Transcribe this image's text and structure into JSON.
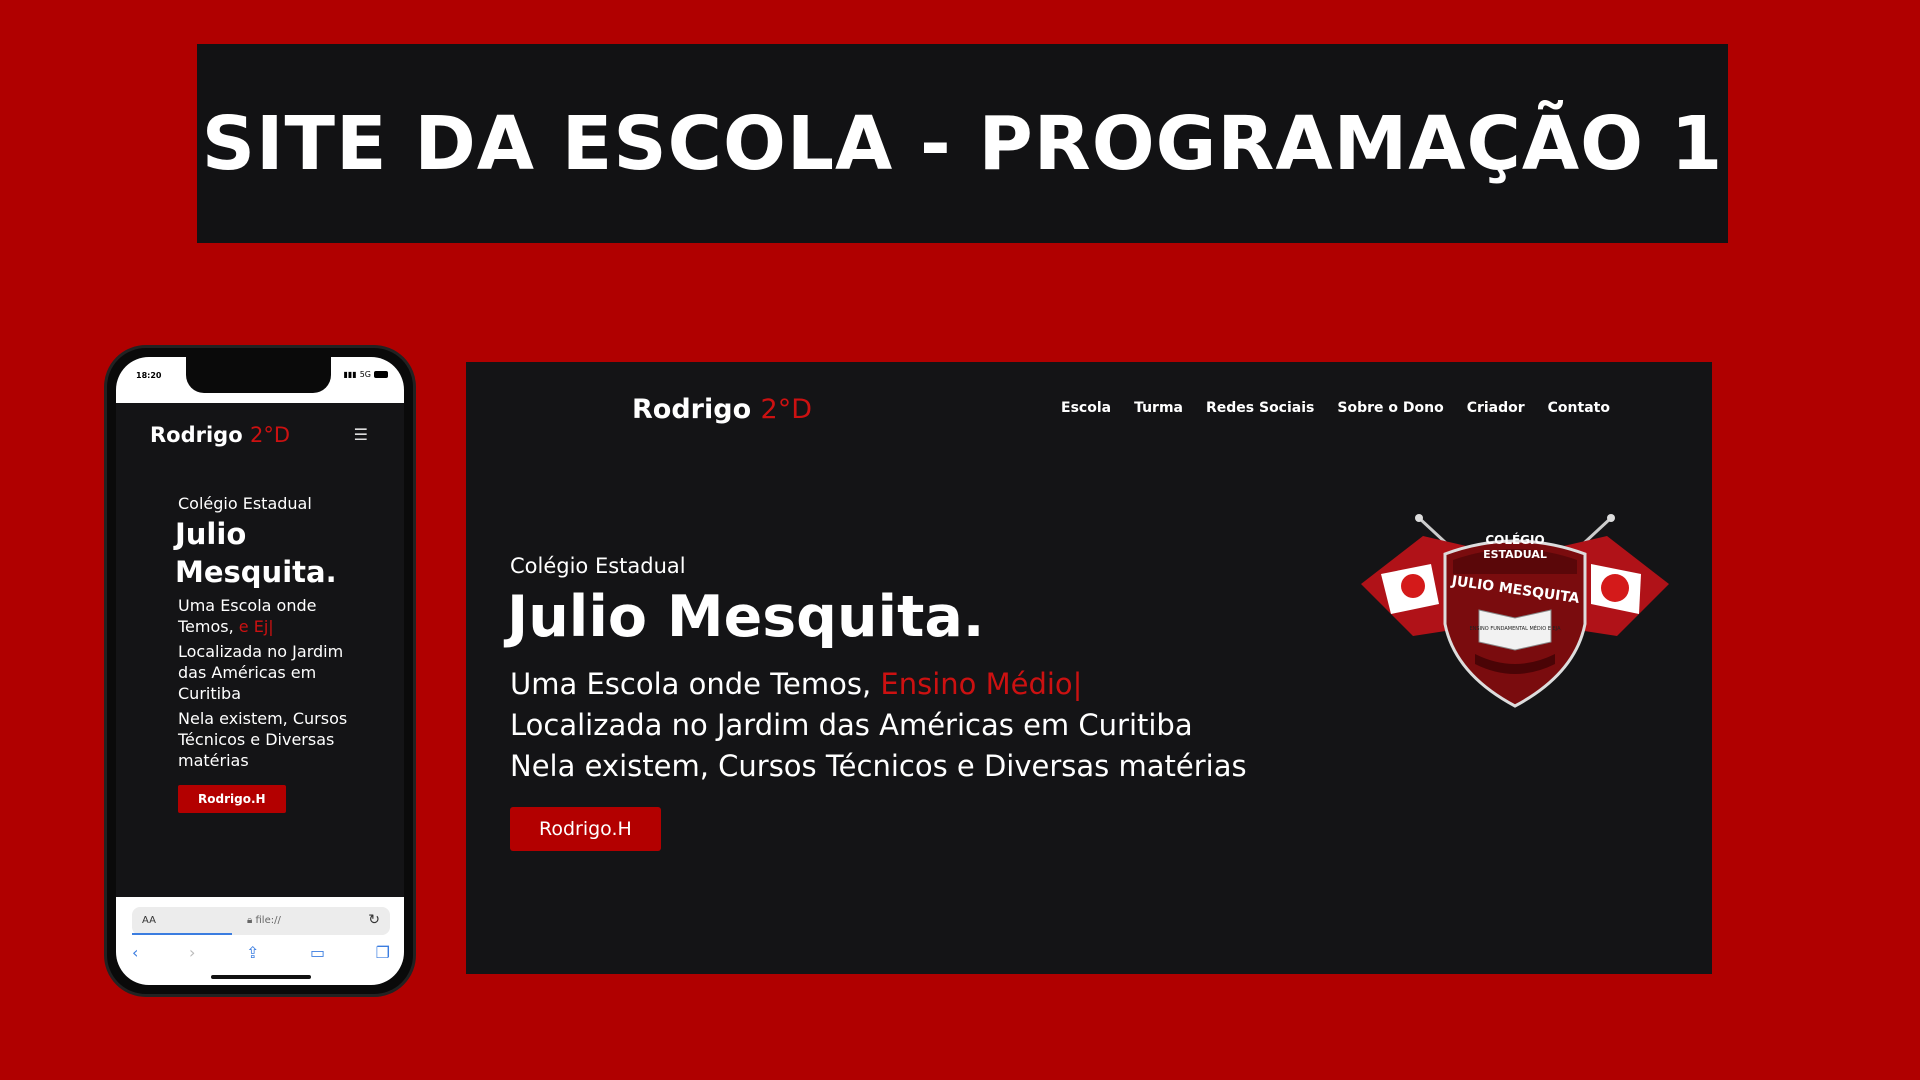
{
  "banner": {
    "title": "SITE DA ESCOLA - PROGRAMAÇÃO 1"
  },
  "colors": {
    "background": "#b00000",
    "panel": "#141416",
    "accent": "#cc1111",
    "button": "#b30000"
  },
  "desktop": {
    "logo_name": "Rodrigo",
    "logo_accent": "2°D",
    "nav": [
      "Escola",
      "Turma",
      "Redes Sociais",
      "Sobre o Dono",
      "Criador",
      "Contato"
    ],
    "kicker": "Colégio Estadual",
    "title": "Julio Mesquita.",
    "line1_prefix": "Uma Escola onde Temos, ",
    "line1_typed": "Ensino Médio|",
    "line2": "Localizada no Jardim das Américas em Curitiba",
    "line3": "Nela existem, Cursos Técnicos e Diversas matérias",
    "button": "Rodrigo.H"
  },
  "crest": {
    "top": "COLÉGIO",
    "middle": "ESTADUAL",
    "name": "JULIO MESQUITA",
    "book": "ENSINO FUNDAMENTAL MÉDIO E EJA"
  },
  "phone": {
    "time": "18:20",
    "signal": "5G",
    "logo_name": "Rodrigo",
    "logo_accent": "2°D",
    "menu_icon": "hamburger-icon",
    "kicker": "Colégio Estadual",
    "title": "Julio Mesquita.",
    "line1_prefix": "Uma Escola onde Temos, ",
    "line1_typed": "e Ej|",
    "line2": "Localizada no Jardim das Américas em Curitiba",
    "line3": "Nela existem, Cursos Técnicos e Diversas matérias",
    "button": "Rodrigo.H",
    "browser": {
      "text_size": "AA",
      "address": "file://"
    }
  }
}
